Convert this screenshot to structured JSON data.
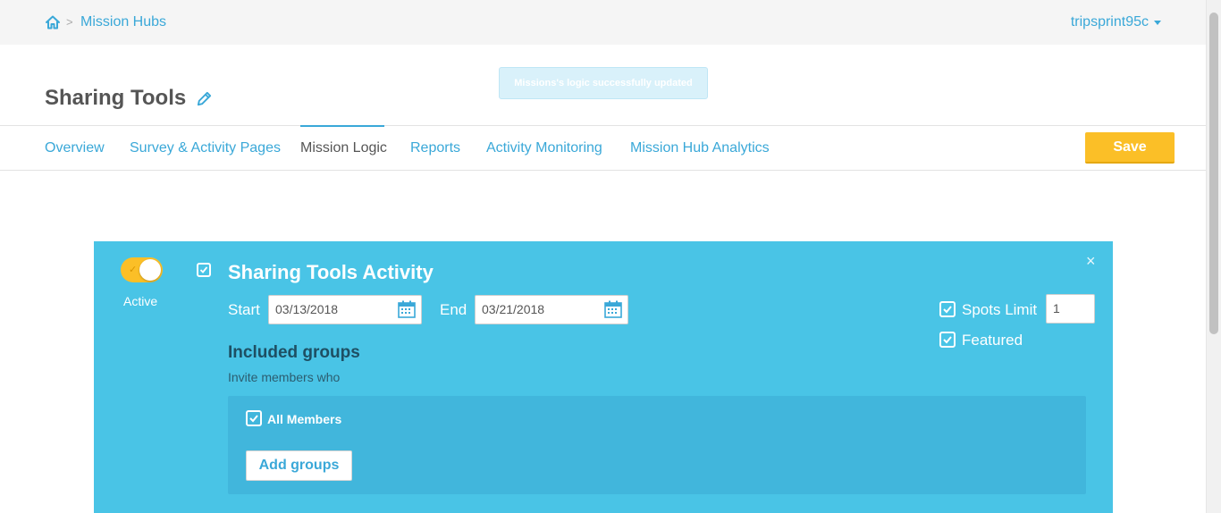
{
  "breadcrumb": {
    "home_icon": "home-icon",
    "separator": ">",
    "current": "Mission Hubs"
  },
  "user": {
    "name": "tripsprint95c"
  },
  "page": {
    "title": "Sharing Tools",
    "edit_icon": "pencil-icon"
  },
  "toast": {
    "message": "Missions's logic successfully updated"
  },
  "tabs": [
    {
      "label": "Overview"
    },
    {
      "label": "Survey & Activity Pages"
    },
    {
      "label": "Mission Logic",
      "active": true
    },
    {
      "label": "Reports"
    },
    {
      "label": "Activity Monitoring"
    },
    {
      "label": "Mission Hub Analytics"
    }
  ],
  "toolbar": {
    "save_label": "Save"
  },
  "activity": {
    "toggle_state": "on",
    "active_label": "Active",
    "enabled_checked": true,
    "title": "Sharing Tools Activity",
    "start_label": "Start",
    "start_date": "03/13/2018",
    "end_label": "End",
    "end_date": "03/21/2018",
    "spots_limit_label": "Spots Limit",
    "spots_limit_checked": true,
    "spots_limit_value": "1",
    "featured_label": "Featured",
    "featured_checked": true,
    "close_icon": "×",
    "groups": {
      "title": "Included groups",
      "subtitle": "Invite members who",
      "all_members_label": "All Members",
      "all_members_checked": true,
      "add_groups_label": "Add groups"
    }
  },
  "colors": {
    "accent": "#3aa8d8",
    "card": "#49c4e6",
    "save": "#fbbf27"
  }
}
